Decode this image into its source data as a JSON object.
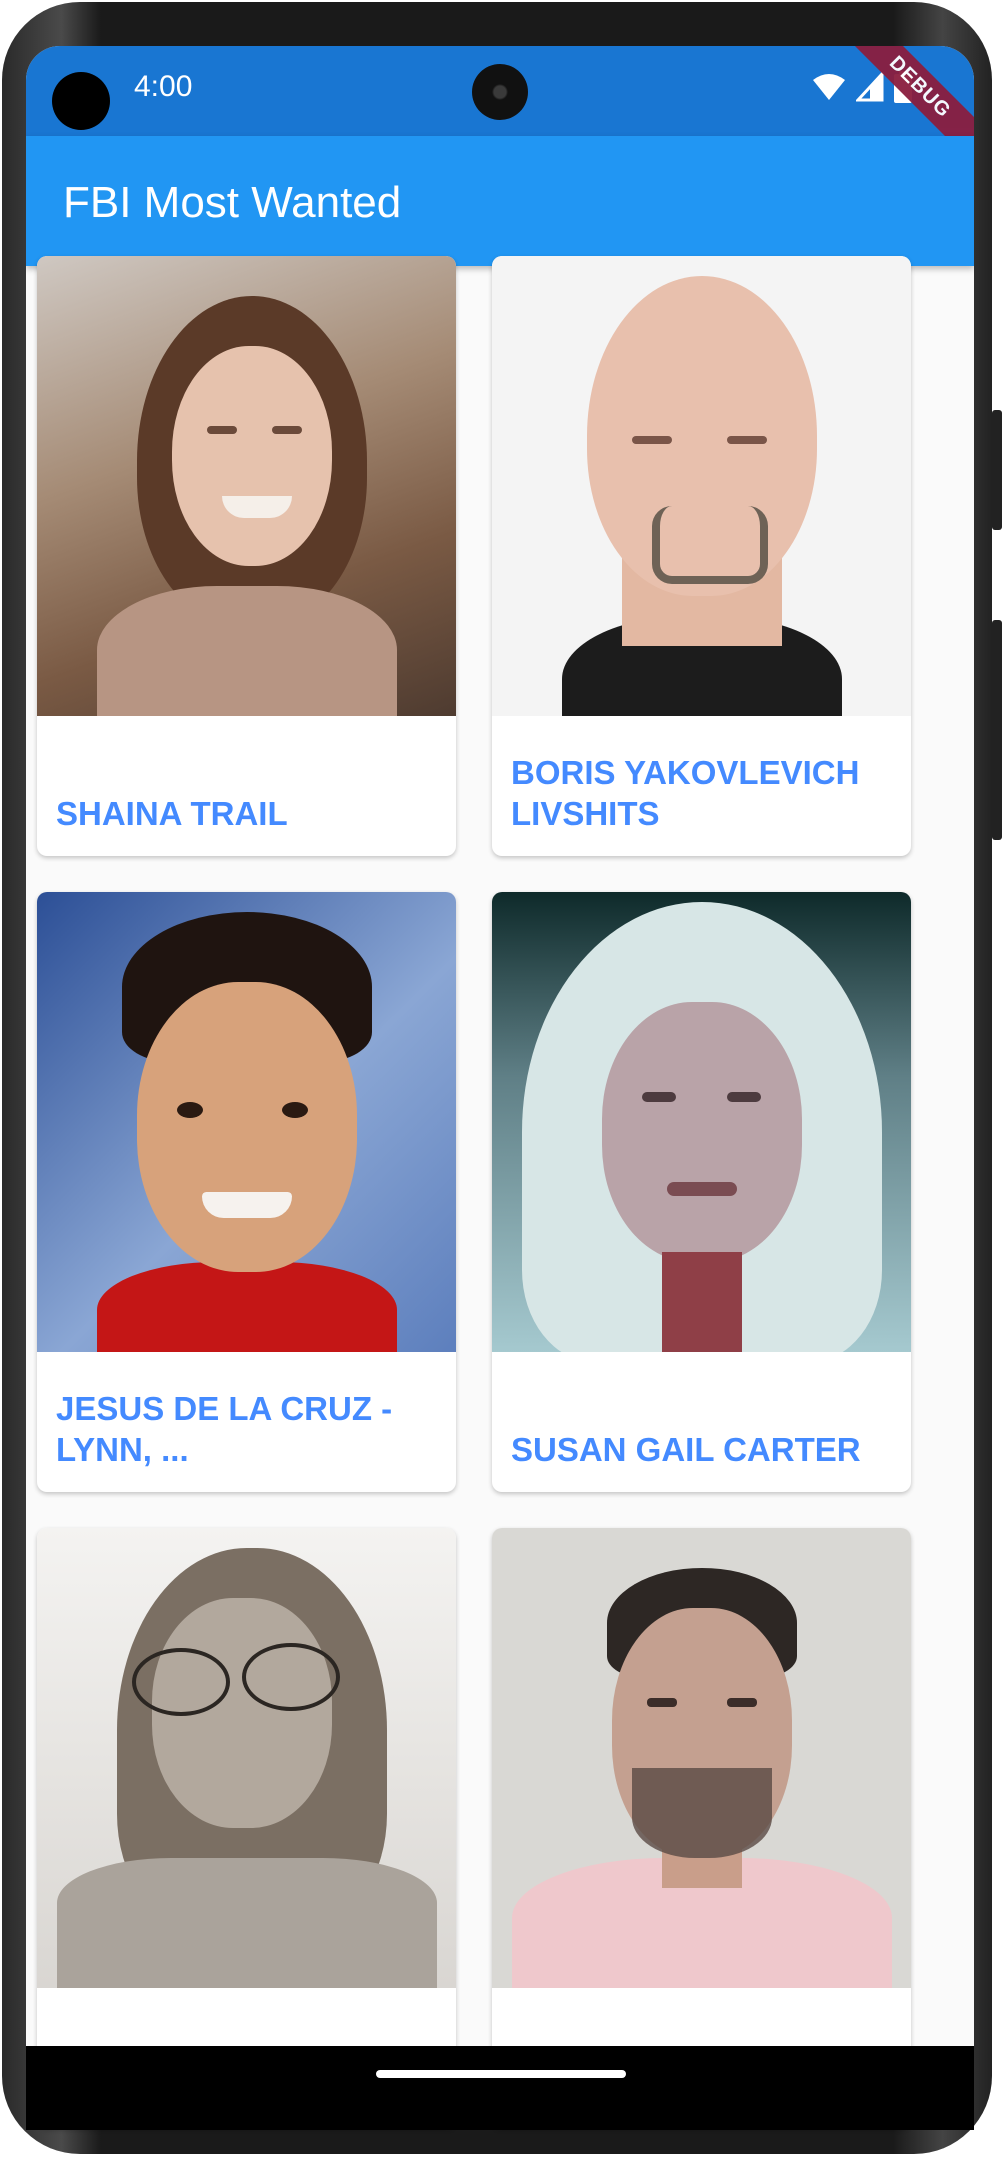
{
  "status_bar": {
    "time": "4:00"
  },
  "debug_banner": "DEBUG",
  "app_bar": {
    "title": "FBI Most Wanted"
  },
  "cards": [
    {
      "name": "SHAINA TRAIL"
    },
    {
      "name": "BORIS YAKOVLEVICH LIVSHITS"
    },
    {
      "name": "JESUS DE LA CRUZ - LYNN, ..."
    },
    {
      "name": "SUSAN GAIL CARTER"
    },
    {
      "name": ""
    },
    {
      "name": ""
    }
  ],
  "colors": {
    "status_bar": "#1976d2",
    "app_bar": "#2196f3",
    "card_title": "#448aff",
    "background": "#fafafa"
  }
}
